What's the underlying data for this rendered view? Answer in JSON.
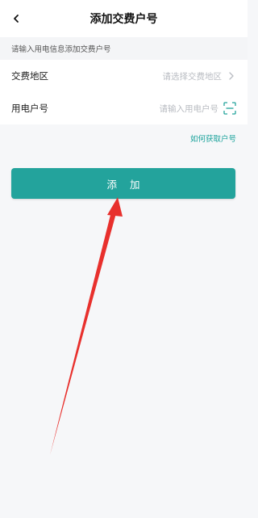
{
  "header": {
    "title": "添加交费户号"
  },
  "hint": "请输入用电信息添加交费户号",
  "form": {
    "region": {
      "label": "交费地区",
      "placeholder": "请选择交费地区"
    },
    "account": {
      "label": "用电户号",
      "placeholder": "请输入用电户号"
    }
  },
  "help_link": "如何获取户号",
  "add_button": "添 加",
  "colors": {
    "accent": "#23a39c",
    "link": "#1aa29b",
    "arrow": "#e8302d"
  },
  "icons": [
    "back-icon",
    "chevron-right-icon",
    "scan-icon"
  ]
}
